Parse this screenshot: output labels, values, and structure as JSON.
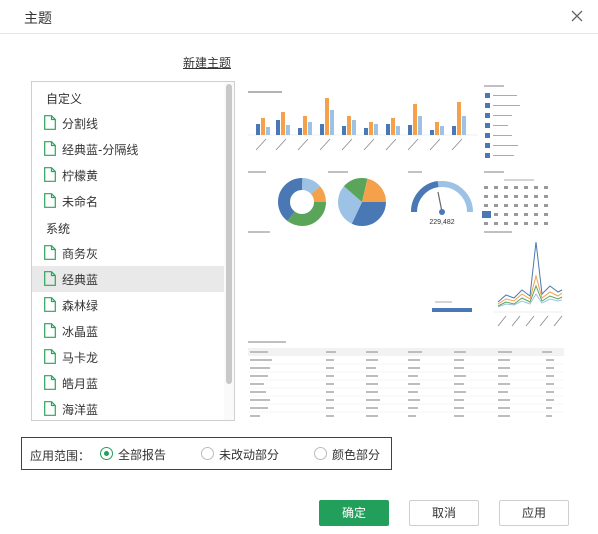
{
  "dialog": {
    "title": "主题"
  },
  "new_theme_label": "新建主题",
  "theme_list": {
    "custom_group": "自定义",
    "custom_items": [
      "分割线",
      "经典蓝-分隔线",
      "柠檬黄",
      "未命名"
    ],
    "system_group": "系统",
    "system_items": [
      "商务灰",
      "经典蓝",
      "森林绿",
      "冰晶蓝",
      "马卡龙",
      "皓月蓝",
      "海洋蓝"
    ],
    "selected": "经典蓝"
  },
  "scope": {
    "label": "应用范围：",
    "options": [
      "全部报告",
      "未改动部分",
      "颜色部分"
    ],
    "selected": "全部报告"
  },
  "buttons": {
    "ok": "确定",
    "cancel": "取消",
    "apply": "应用"
  },
  "preview": {
    "gauge_value": "229,482"
  },
  "colors": {
    "accent": "#22a05b",
    "highlight": "#d0021b",
    "blue": "#4a78b4",
    "orange": "#f5a04a",
    "light_blue": "#9cc3e6",
    "green": "#5aa55a"
  }
}
